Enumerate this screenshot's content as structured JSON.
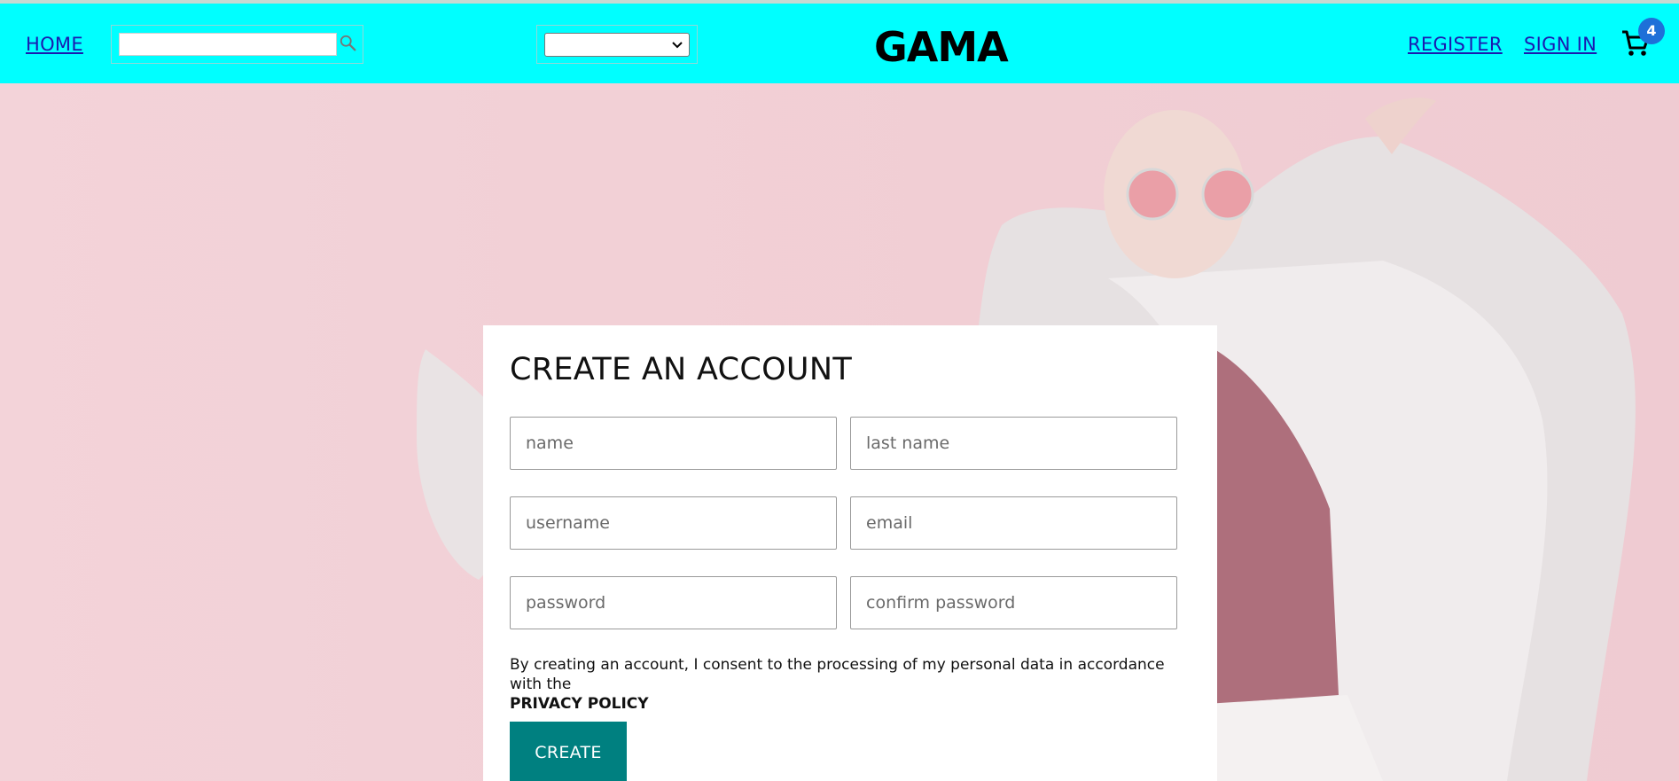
{
  "nav": {
    "home_label": "HOME",
    "search_placeholder": "",
    "select_value": "",
    "logo": "GAMA",
    "register_label": "REGISTER",
    "signin_label": "SIGN IN",
    "cart_count": "4"
  },
  "form": {
    "title": "CREATE AN ACCOUNT",
    "fields": {
      "name": "name",
      "last_name": "last name",
      "username": "username",
      "email": "email",
      "password": "password",
      "confirm_password": "confirm password"
    },
    "consent_text": "By creating an account, I consent to the processing of my personal data in accordance with the",
    "privacy_policy": "PRIVACY POLICY",
    "create_label": "CREATE"
  },
  "colors": {
    "navbar": "#00ffff",
    "accent_button": "#008080",
    "cart_badge": "#1e70d8",
    "link": "#1a1ab0"
  },
  "icons": {
    "search": "search-icon",
    "cart": "cart-icon",
    "select_chevron": "chevron-down-icon"
  }
}
